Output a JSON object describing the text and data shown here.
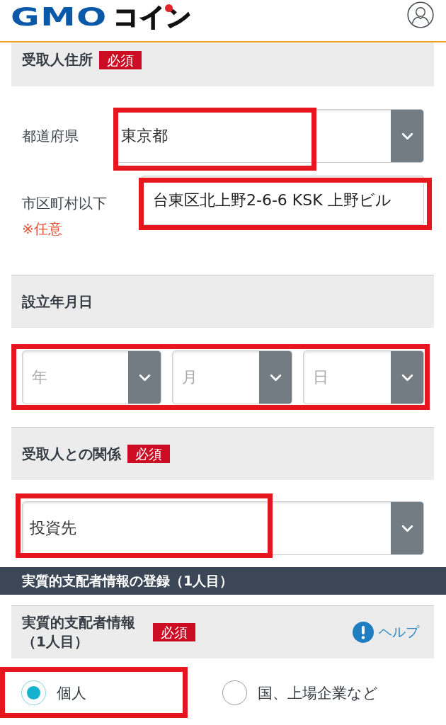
{
  "header": {
    "logo": {
      "latin": "GMO",
      "kana": "コイン"
    }
  },
  "blocks": [
    {
      "kind": "section",
      "title": "受取人住所",
      "badge": "必須",
      "rows": [
        {
          "kind": "select",
          "label": "都道府県",
          "value": "東京都",
          "highlighted": true
        },
        {
          "kind": "text",
          "label": "市区町村以下",
          "note": "※任意",
          "value": "台東区北上野2-6-6 KSK 上野ビル",
          "highlighted": true
        }
      ]
    },
    {
      "kind": "section",
      "title": "設立年月日",
      "rows": [
        {
          "kind": "date",
          "highlighted": true,
          "parts": [
            {
              "placeholder": "年"
            },
            {
              "placeholder": "月"
            },
            {
              "placeholder": "日"
            }
          ]
        }
      ]
    },
    {
      "kind": "section",
      "title": "受取人との関係",
      "badge": "必須",
      "rows": [
        {
          "kind": "select",
          "value": "投資先",
          "highlighted": true
        }
      ]
    },
    {
      "kind": "band",
      "title": "実質的支配者情報の登録（1人目）"
    },
    {
      "kind": "section",
      "title": "実質的支配者情報（1人目）",
      "badge": "必須",
      "help": "ヘルプ",
      "rows": [
        {
          "kind": "radio",
          "options": [
            {
              "label": "個人",
              "selected": true,
              "highlighted": true
            },
            {
              "label": "国、上場企業など",
              "selected": false,
              "highlighted": false
            }
          ]
        }
      ]
    }
  ]
}
